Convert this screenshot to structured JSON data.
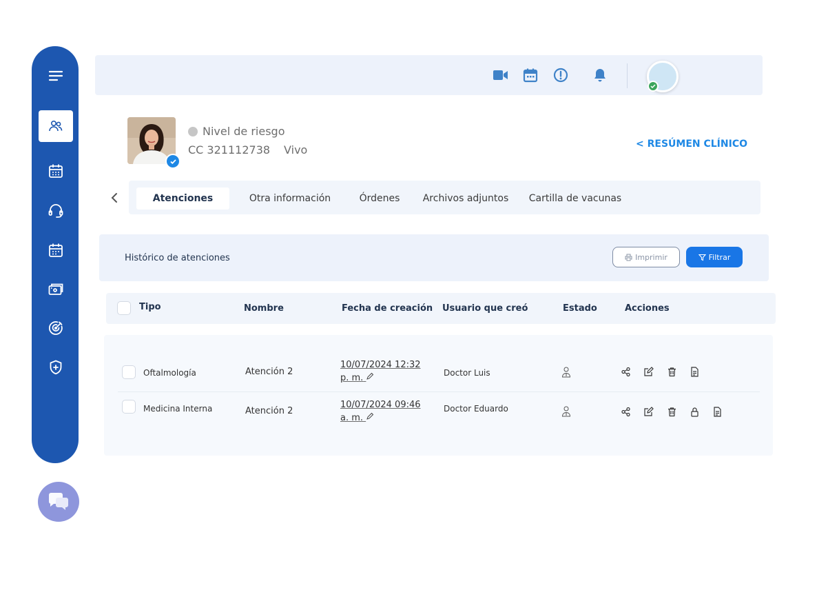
{
  "sidebar": {
    "items": [
      {
        "icon": "menu-icon"
      },
      {
        "icon": "users-icon",
        "active": true
      },
      {
        "icon": "calendar-icon"
      },
      {
        "icon": "headset-icon"
      },
      {
        "icon": "calendar-grid-icon"
      },
      {
        "icon": "payments-icon"
      },
      {
        "icon": "target-icon"
      },
      {
        "icon": "shield-plus-icon"
      }
    ],
    "color": "#1d57b0"
  },
  "topbar": {
    "icons": [
      "video-icon",
      "calendar-icon",
      "alert-icon",
      "bell-icon"
    ],
    "icon_color": "#3f82c8",
    "avatar_status_color": "#3ba55c"
  },
  "patient": {
    "risk_label": "Nivel de riesgo",
    "document": "CC 321112738",
    "status": "Vivo"
  },
  "clinical_summary_link": "< RESÚMEN CLÍNICO",
  "tabs": [
    {
      "label": "Atenciones",
      "active": true
    },
    {
      "label": "Otra información"
    },
    {
      "label": "Órdenes"
    },
    {
      "label": "Archivos adjuntos"
    },
    {
      "label": "Cartilla de vacunas"
    }
  ],
  "history": {
    "title": "Histórico de atenciones",
    "print_label": "Imprimir",
    "filter_label": "Filtrar"
  },
  "table": {
    "columns": [
      "Tipo",
      "Nombre",
      "Fecha de creación",
      "Usuario que creó",
      "Estado",
      "Acciones"
    ],
    "rows": [
      {
        "tipo": "Oftalmología",
        "nombre": "Atención 2",
        "fecha_line1": "10/07/2024 12:32",
        "fecha_line2": "p. m.",
        "usuario": "Doctor Luis",
        "actions": [
          "share-icon",
          "edit-icon",
          "trash-icon",
          "document-icon"
        ]
      },
      {
        "tipo": "Medicina Interna",
        "nombre": "Atención 2",
        "fecha_line1": "10/07/2024 09:46",
        "fecha_line2": "a. m.",
        "usuario": "Doctor Eduardo",
        "actions": [
          "share-icon",
          "edit-icon",
          "trash-icon",
          "lock-icon",
          "document-icon"
        ]
      }
    ]
  },
  "accent_color": "#1976e6"
}
